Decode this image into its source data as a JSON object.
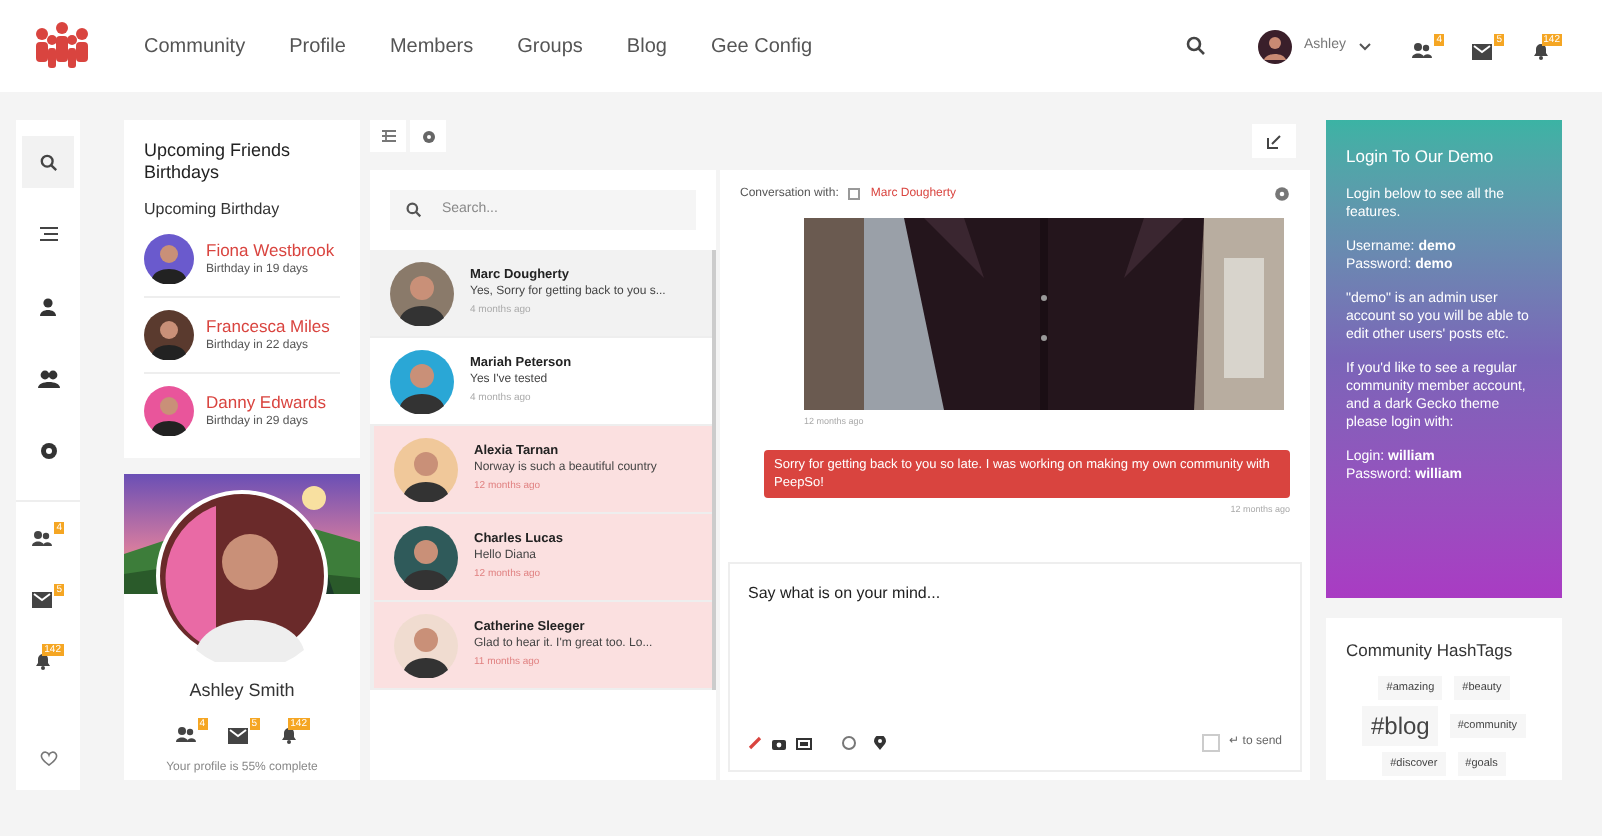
{
  "header": {
    "nav": [
      "Community",
      "Profile",
      "Members",
      "Groups",
      "Blog",
      "Gee Config"
    ],
    "user": "Ashley",
    "badges": [
      "4",
      "5",
      "142"
    ]
  },
  "sidebar": {
    "items": [
      {
        "selected": true
      },
      {
        "selected": false
      },
      {
        "selected": false
      },
      {
        "selected": false
      },
      {
        "selected": false
      }
    ],
    "notifications": [
      "4",
      "5",
      "142"
    ]
  },
  "birthdays": {
    "title": "Upcoming Friends Birthdays",
    "subtitle": "Upcoming Birthday",
    "people": [
      {
        "name": "Fiona Westbrook",
        "when": "Birthday in 19 days",
        "color": "#6a5acd"
      },
      {
        "name": "Francesca Miles",
        "when": "Birthday in 22 days",
        "color": "#5a3a2e"
      },
      {
        "name": "Danny Edwards",
        "when": "Birthday in 29 days",
        "color": "#e9559b"
      }
    ]
  },
  "profile": {
    "name": "Ashley Smith",
    "badges": [
      "4",
      "5",
      "142"
    ],
    "completion": "Your profile is 55% complete"
  },
  "chats": {
    "search_placeholder": "Search...",
    "items": [
      {
        "name": "Marc Dougherty",
        "preview": "Yes, Sorry for getting back to you s...",
        "time": "4 months ago",
        "selected": true,
        "unread": false
      },
      {
        "name": "Mariah Peterson",
        "preview": "Yes I've tested",
        "time": "4 months ago",
        "selected": false,
        "unread": false
      },
      {
        "name": "Alexia Tarnan",
        "preview": "Norway is such a beautiful country",
        "time": "12 months ago",
        "selected": false,
        "unread": true
      },
      {
        "name": "Charles Lucas",
        "preview": "Hello Diana",
        "time": "12 months ago",
        "selected": false,
        "unread": true
      },
      {
        "name": "Catherine Sleeger",
        "preview": "Glad to hear it. I'm great too. Lo...",
        "time": "11 months ago",
        "selected": false,
        "unread": true
      }
    ]
  },
  "conversation": {
    "label": "Conversation with:",
    "with": "Marc Dougherty",
    "messages": [
      {
        "kind": "picture",
        "time": "12 months ago"
      },
      {
        "kind": "text",
        "text": "Sorry for getting back to you so late. I was working on making my own community with PeepSo!",
        "time": "12 months ago"
      }
    ],
    "composer": {
      "placeholder": "Say what is on your mind...",
      "enter_to_send": false,
      "send_label": "↵ to send"
    }
  },
  "login_card": {
    "title": "Login To Our Demo",
    "paragraphs": [
      "Login below to see all the features.",
      "Username: **demo**\nPassword: **demo**",
      "\"demo\" is an admin user account so you will be able to edit other users' posts etc.",
      "If you'd like to see a regular community member account, and a dark Gecko theme please login with:",
      "Login: **william**\nPassword: **william**"
    ]
  },
  "hashtags": {
    "title": "Community HashTags",
    "tags": [
      {
        "tag": "#amazing",
        "kind": "small"
      },
      {
        "tag": "#beauty",
        "kind": "small"
      },
      {
        "tag": "#blog",
        "kind": "large"
      },
      {
        "tag": "#community",
        "kind": "small"
      },
      {
        "tag": "#discover",
        "kind": "small"
      },
      {
        "tag": "#goals",
        "kind": "small"
      }
    ]
  }
}
